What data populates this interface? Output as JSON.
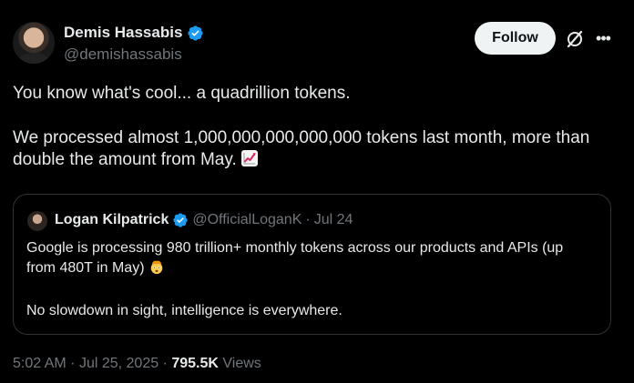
{
  "author": {
    "display_name": "Demis Hassabis",
    "handle": "@demishassabis",
    "verified_icon": "verified-badge-icon"
  },
  "actions": {
    "follow_label": "Follow",
    "grok_icon": "grok-icon",
    "more_icon": "more-icon"
  },
  "tweet": {
    "paragraph_1": "You know what's cool... a quadrillion tokens.",
    "paragraph_2": "We processed almost 1,000,000,000,000,000 tokens last month, more than double the amount from May.",
    "emoji": "chart-increasing-emoji"
  },
  "quoted_tweet": {
    "display_name": "Logan Kilpatrick",
    "handle": "@OfficialLoganK",
    "separator": "·",
    "date": "Jul 24",
    "line_1": "Google is processing 980 trillion+ monthly tokens across our products and APIs (up from 480T in May)",
    "emoji": "exploding-head-emoji",
    "line_2": "No slowdown in sight, intelligence is everywhere."
  },
  "meta": {
    "time": "5:02 AM",
    "separator": "·",
    "date": "Jul 25, 2025",
    "views_count": "795.5K",
    "views_label": "Views"
  },
  "colors": {
    "background": "#000000",
    "text_primary": "#e7e9ea",
    "text_secondary": "#71767b",
    "verified_blue": "#1d9bf0",
    "border": "#2f3336"
  }
}
